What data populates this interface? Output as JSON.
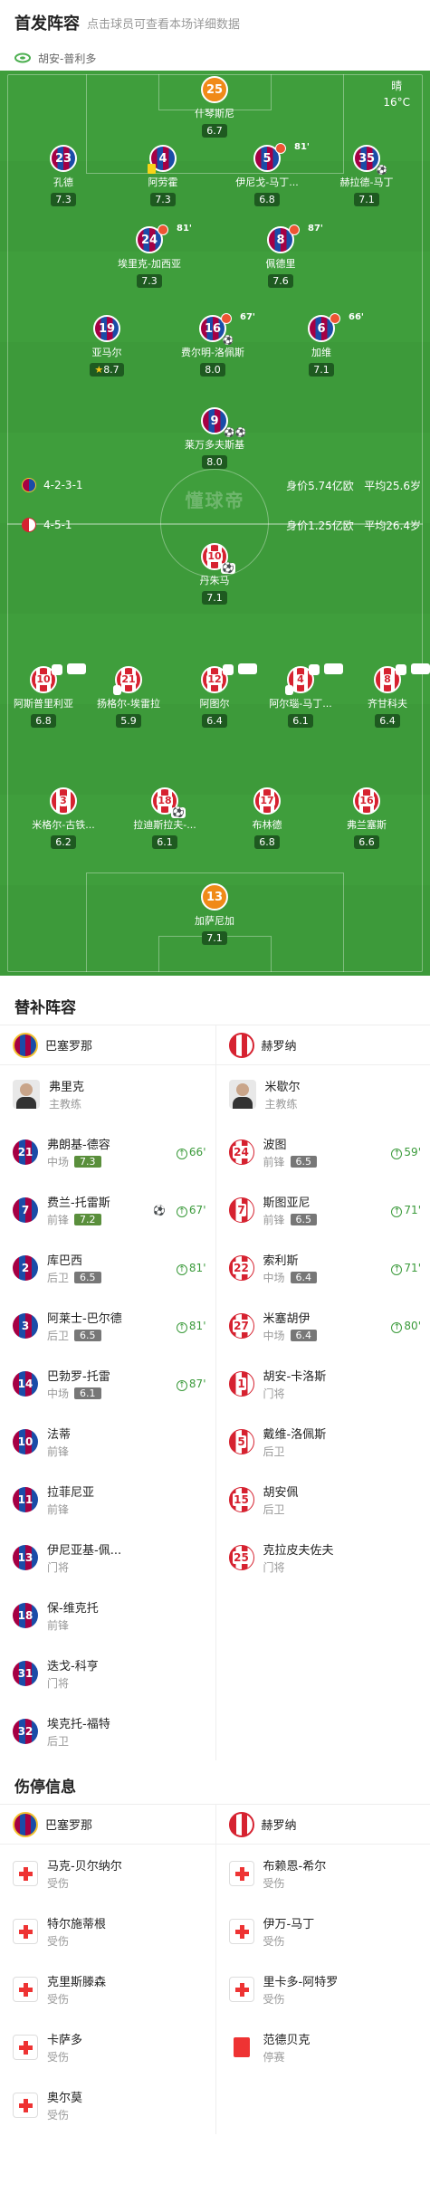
{
  "header": {
    "title": "首发阵容",
    "subtitle": "点击球员可查看本场详细数据"
  },
  "venue": {
    "name": "胡安-普利多",
    "icon": "stadium-icon"
  },
  "weather": {
    "condition": "晴",
    "temp": "16°C"
  },
  "watermark": "懂球帝",
  "formations": {
    "home": {
      "shape": "4-2-3-1",
      "value": "身价5.74亿欧",
      "age": "平均25.6岁"
    },
    "away": {
      "shape": "4-5-1",
      "value": "身价1.25亿欧",
      "age": "平均26.4岁"
    }
  },
  "lineup_top": [
    {
      "num": "25",
      "name": "什琴斯尼",
      "rating": "6.7",
      "kit": "gk"
    },
    {
      "num": "23",
      "name": "孔德",
      "rating": "7.3",
      "kit": "bar"
    },
    {
      "num": "4",
      "name": "阿劳霍",
      "rating": "7.3",
      "kit": "bar",
      "yellow": true
    },
    {
      "num": "5",
      "name": "伊尼戈-马丁...",
      "rating": "6.8",
      "kit": "bar",
      "sub": "81'"
    },
    {
      "num": "35",
      "name": "赫拉德-马丁",
      "rating": "7.1",
      "kit": "bar",
      "ball": true
    },
    {
      "num": "24",
      "name": "埃里克-加西亚",
      "rating": "7.3",
      "kit": "bar",
      "sub": "81'"
    },
    {
      "num": "8",
      "name": "佩德里",
      "rating": "7.6",
      "kit": "bar",
      "sub": "87'"
    },
    {
      "num": "19",
      "name": "亚马尔",
      "rating": "8.7",
      "kit": "bar",
      "star": true
    },
    {
      "num": "16",
      "name": "费尔明-洛佩斯",
      "rating": "8.0",
      "kit": "bar",
      "sub": "67'",
      "ball": true
    },
    {
      "num": "6",
      "name": "加维",
      "rating": "7.1",
      "kit": "bar",
      "sub": "66'"
    },
    {
      "num": "9",
      "name": "莱万多夫斯基",
      "rating": "8.0",
      "kit": "bar",
      "balls": "⚽⚽"
    }
  ],
  "lineup_bottom": [
    {
      "num": "10",
      "name": "丹朱马",
      "rating": "7.1",
      "kit": "gir",
      "ball": true
    },
    {
      "num": "10",
      "name": "阿斯普里利亚",
      "rating": "6.8",
      "kit": "gir",
      "sub": "59'"
    },
    {
      "num": "21",
      "name": "扬格尔-埃雷拉",
      "rating": "5.9",
      "kit": "gir",
      "yellow": true
    },
    {
      "num": "12",
      "name": "阿图尔",
      "rating": "6.4",
      "kit": "gir",
      "sub": "71'"
    },
    {
      "num": "4",
      "name": "阿尔瑙-马丁...",
      "rating": "6.1",
      "kit": "gir",
      "sub": "80'",
      "yellow": true
    },
    {
      "num": "8",
      "name": "齐甘科夫",
      "rating": "6.4",
      "kit": "gir",
      "sub": "71'"
    },
    {
      "num": "3",
      "name": "米格尔-古铁...",
      "rating": "6.2",
      "kit": "gir"
    },
    {
      "num": "18",
      "name": "拉迪斯拉夫-...",
      "rating": "6.1",
      "kit": "gir",
      "ball": true
    },
    {
      "num": "17",
      "name": "布林德",
      "rating": "6.8",
      "kit": "gir"
    },
    {
      "num": "16",
      "name": "弗兰塞斯",
      "rating": "6.6",
      "kit": "gir"
    },
    {
      "num": "13",
      "name": "加萨尼加",
      "rating": "7.1",
      "kit": "gk"
    }
  ],
  "subs_section": {
    "title": "替补阵容"
  },
  "teams": {
    "home": "巴塞罗那",
    "away": "赫罗纳"
  },
  "subs_home": [
    {
      "type": "coach",
      "name": "弗里克",
      "pos": "主教练"
    },
    {
      "num": "21",
      "name": "弗朗基-德容",
      "pos": "中场",
      "rating": "7.3",
      "in": "66'"
    },
    {
      "num": "7",
      "name": "费兰-托雷斯",
      "pos": "前锋",
      "rating": "7.2",
      "in": "67'",
      "goal": true
    },
    {
      "num": "2",
      "name": "库巴西",
      "pos": "后卫",
      "rating": "6.5",
      "in": "81'"
    },
    {
      "num": "3",
      "name": "阿莱士-巴尔德",
      "pos": "后卫",
      "rating": "6.5",
      "in": "81'"
    },
    {
      "num": "14",
      "name": "巴勃罗-托雷",
      "pos": "中场",
      "rating": "6.1",
      "in": "87'"
    },
    {
      "num": "10",
      "name": "法蒂",
      "pos": "前锋"
    },
    {
      "num": "11",
      "name": "拉菲尼亚",
      "pos": "前锋"
    },
    {
      "num": "13",
      "name": "伊尼亚基-佩...",
      "pos": "门将"
    },
    {
      "num": "18",
      "name": "保-维克托",
      "pos": "前锋"
    },
    {
      "num": "31",
      "name": "迭戈-科亨",
      "pos": "门将"
    },
    {
      "num": "32",
      "name": "埃克托-福特",
      "pos": "后卫"
    }
  ],
  "subs_away": [
    {
      "type": "coach",
      "name": "米歇尔",
      "pos": "主教练"
    },
    {
      "num": "24",
      "name": "波图",
      "pos": "前锋",
      "rating": "6.5",
      "in": "59'"
    },
    {
      "num": "7",
      "name": "斯图亚尼",
      "pos": "前锋",
      "rating": "6.5",
      "in": "71'"
    },
    {
      "num": "22",
      "name": "索利斯",
      "pos": "中场",
      "rating": "6.4",
      "in": "71'"
    },
    {
      "num": "27",
      "name": "米塞胡伊",
      "pos": "中场",
      "rating": "6.4",
      "in": "80'"
    },
    {
      "num": "1",
      "name": "胡安-卡洛斯",
      "pos": "门将"
    },
    {
      "num": "5",
      "name": "戴维-洛佩斯",
      "pos": "后卫"
    },
    {
      "num": "15",
      "name": "胡安佩",
      "pos": "后卫"
    },
    {
      "num": "25",
      "name": "克拉皮夫佐夫",
      "pos": "门将"
    }
  ],
  "injury_section": {
    "title": "伤停信息"
  },
  "injury_home": [
    {
      "name": "马克-贝尔纳尔",
      "status": "受伤"
    },
    {
      "name": "特尔施蒂根",
      "status": "受伤"
    },
    {
      "name": "克里斯滕森",
      "status": "受伤"
    },
    {
      "name": "卡萨多",
      "status": "受伤"
    },
    {
      "name": "奥尔莫",
      "status": "受伤"
    }
  ],
  "injury_away": [
    {
      "name": "布赖恩-希尔",
      "status": "受伤"
    },
    {
      "name": "伊万-马丁",
      "status": "受伤"
    },
    {
      "name": "里卡多-阿特罗",
      "status": "受伤"
    },
    {
      "name": "范德贝克",
      "status": "停赛",
      "suspended": true
    }
  ],
  "colors": {
    "pitch": "#3d9a3a",
    "barca_red": "#a50044",
    "barca_blue": "#1a4ca8",
    "girona_red": "#d62230",
    "gk": "#f08a18"
  }
}
